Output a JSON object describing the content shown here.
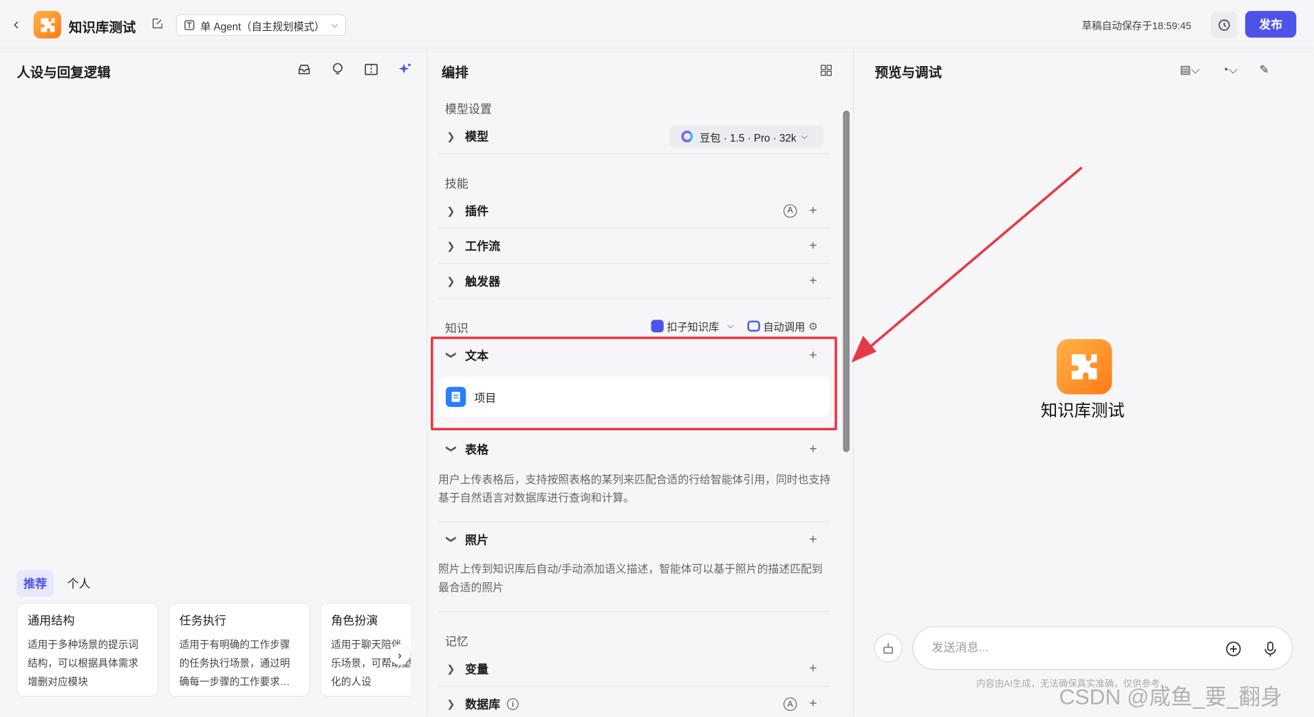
{
  "header": {
    "title": "知识库测试",
    "agent_mode": "单 Agent（自主规划模式）",
    "autosave": "草稿自动保存于18:59:45",
    "publish_label": "发布"
  },
  "left": {
    "title": "人设与回复逻辑",
    "tabs": [
      "推荐",
      "个人"
    ],
    "cards": [
      {
        "title": "通用结构",
        "desc": "适用于多种场景的提示词结构，可以根据具体需求增删对应模块"
      },
      {
        "title": "任务执行",
        "desc": "适用于有明确的工作步骤的任务执行场景，通过明确每一步骤的工作要求…"
      },
      {
        "title": "角色扮演",
        "desc": "适用于聊天陪伴、互动娱乐场景，可帮助塑造个性化的人设"
      }
    ]
  },
  "mid": {
    "title": "编排",
    "model_section": "模型设置",
    "model_label": "模型",
    "model_value": "豆包 · 1.5 · Pro · 32k",
    "skills_section": "技能",
    "skills": [
      "插件",
      "工作流",
      "触发器"
    ],
    "knowledge_section": "知识",
    "kb_source": "扣子知识库",
    "kb_mode": "自动调用",
    "text_label": "文本",
    "text_item": "项目",
    "table_label": "表格",
    "table_desc": "用户上传表格后，支持按照表格的某列来匹配合适的行给智能体引用，同时也支持基于自然语言对数据库进行查询和计算。",
    "photo_label": "照片",
    "photo_desc": "照片上传到知识库后自动/手动添加语义描述，智能体可以基于照片的描述匹配到最合适的照片",
    "memory_section": "记忆",
    "memory": [
      "变量",
      "数据库"
    ]
  },
  "right": {
    "title": "预览与调试",
    "bot_name": "知识库测试",
    "input_placeholder": "发送消息...",
    "disclaimer": "内容由AI生成，无法确保真实准确，仅供参考。"
  },
  "watermark": "CSDN @咸鱼_要_翻身",
  "colors": {
    "accent": "#4d53e8",
    "highlight": "#e63946"
  }
}
